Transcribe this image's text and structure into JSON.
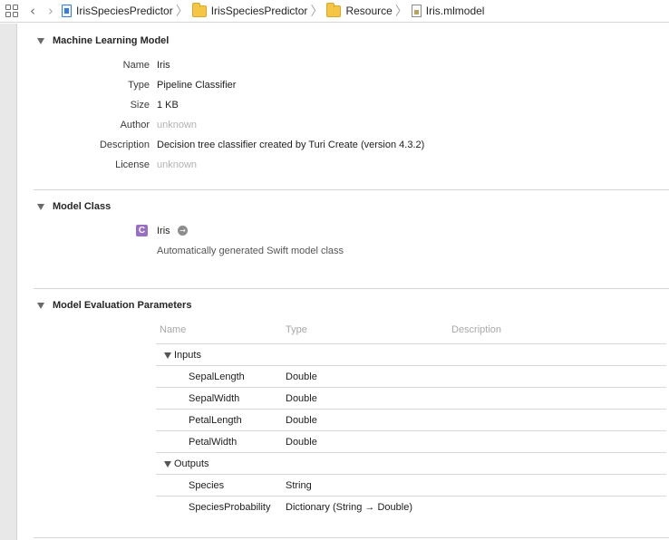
{
  "jumpbar": {
    "breadcrumbs": [
      {
        "label": "IrisSpeciesPredictor",
        "icon": "project-icon"
      },
      {
        "label": "IrisSpeciesPredictor",
        "icon": "folder-icon"
      },
      {
        "label": "Resource",
        "icon": "folder-icon"
      },
      {
        "label": "Iris.mlmodel",
        "icon": "mlmodel-file-icon"
      }
    ]
  },
  "ml_model": {
    "title": "Machine Learning Model",
    "fields": [
      {
        "label": "Name",
        "value": "Iris"
      },
      {
        "label": "Type",
        "value": "Pipeline Classifier"
      },
      {
        "label": "Size",
        "value": "1 KB"
      },
      {
        "label": "Author",
        "value": "unknown"
      },
      {
        "label": "Description",
        "value": "Decision tree classifier created by Turi Create (version 4.3.2)"
      },
      {
        "label": "License",
        "value": "unknown"
      }
    ]
  },
  "model_class": {
    "title": "Model Class",
    "badge": "C",
    "name": "Iris",
    "description": "Automatically generated Swift model class"
  },
  "eval_params": {
    "title": "Model Evaluation Parameters",
    "columns": [
      "Name",
      "Type",
      "Description"
    ],
    "inputs_label": "Inputs",
    "inputs": [
      {
        "name": "SepalLength",
        "type": "Double"
      },
      {
        "name": "SepalWidth",
        "type": "Double"
      },
      {
        "name": "PetalLength",
        "type": "Double"
      },
      {
        "name": "PetalWidth",
        "type": "Double"
      }
    ],
    "outputs_label": "Outputs",
    "outputs": [
      {
        "name": "Species",
        "type": "String"
      },
      {
        "name": "SpeciesProbability",
        "type": "Dictionary (String → Double)"
      }
    ]
  },
  "colors": {
    "class_badge": "#9a6ec4",
    "folder": "#f5c544",
    "project": "#3a7bd5"
  }
}
